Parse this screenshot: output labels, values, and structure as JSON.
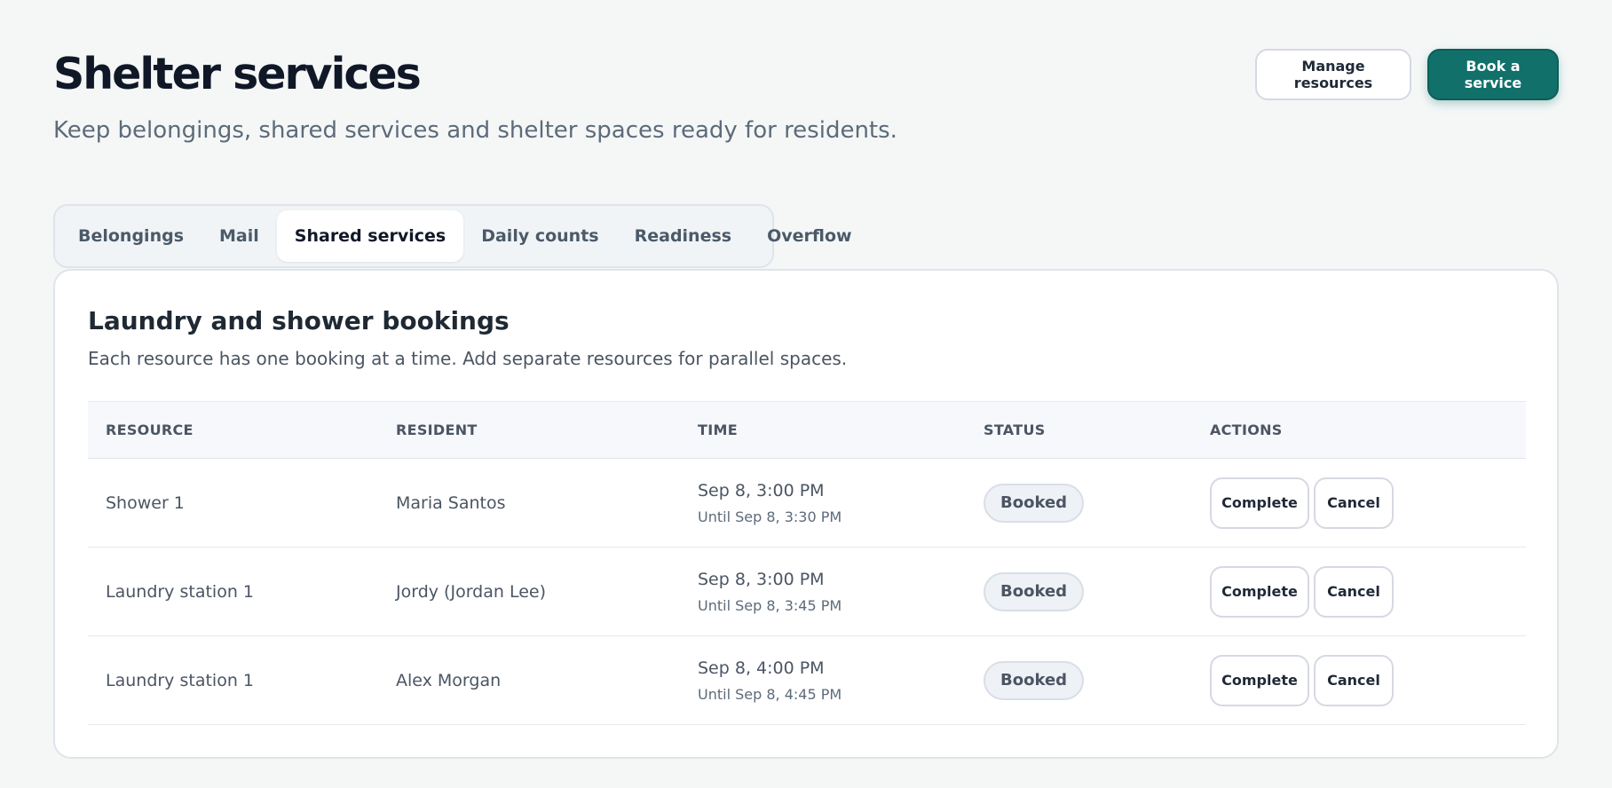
{
  "header": {
    "title": "Shelter services",
    "subtitle": "Keep belongings, shared services and shelter spaces ready for residents.",
    "manage_label": "Manage resources",
    "book_label": "Book a service"
  },
  "tabs": [
    {
      "label": "Belongings",
      "active": false
    },
    {
      "label": "Mail",
      "active": false
    },
    {
      "label": "Shared services",
      "active": true
    },
    {
      "label": "Daily counts",
      "active": false
    },
    {
      "label": "Readiness",
      "active": false
    },
    {
      "label": "Overflow",
      "active": false
    }
  ],
  "card": {
    "title": "Laundry and shower bookings",
    "description": "Each resource has one booking at a time. Add separate resources for parallel spaces."
  },
  "table": {
    "columns": [
      "RESOURCE",
      "RESIDENT",
      "TIME",
      "STATUS",
      "ACTIONS"
    ],
    "rows": [
      {
        "resource": "Shower 1",
        "resident": "Maria Santos",
        "time": "Sep 8, 3:00 PM",
        "until": "Until Sep 8, 3:30 PM",
        "status": "Booked",
        "complete_label": "Complete",
        "cancel_label": "Cancel"
      },
      {
        "resource": "Laundry station 1",
        "resident": "Jordy (Jordan Lee)",
        "time": "Sep 8, 3:00 PM",
        "until": "Until Sep 8, 3:45 PM",
        "status": "Booked",
        "complete_label": "Complete",
        "cancel_label": "Cancel"
      },
      {
        "resource": "Laundry station 1",
        "resident": "Alex Morgan",
        "time": "Sep 8, 4:00 PM",
        "until": "Until Sep 8, 4:45 PM",
        "status": "Booked",
        "complete_label": "Complete",
        "cancel_label": "Cancel"
      }
    ]
  },
  "colors": {
    "accent": "#12706b",
    "page_background": "#f5f7f7",
    "badge_background": "#eef1f5"
  }
}
